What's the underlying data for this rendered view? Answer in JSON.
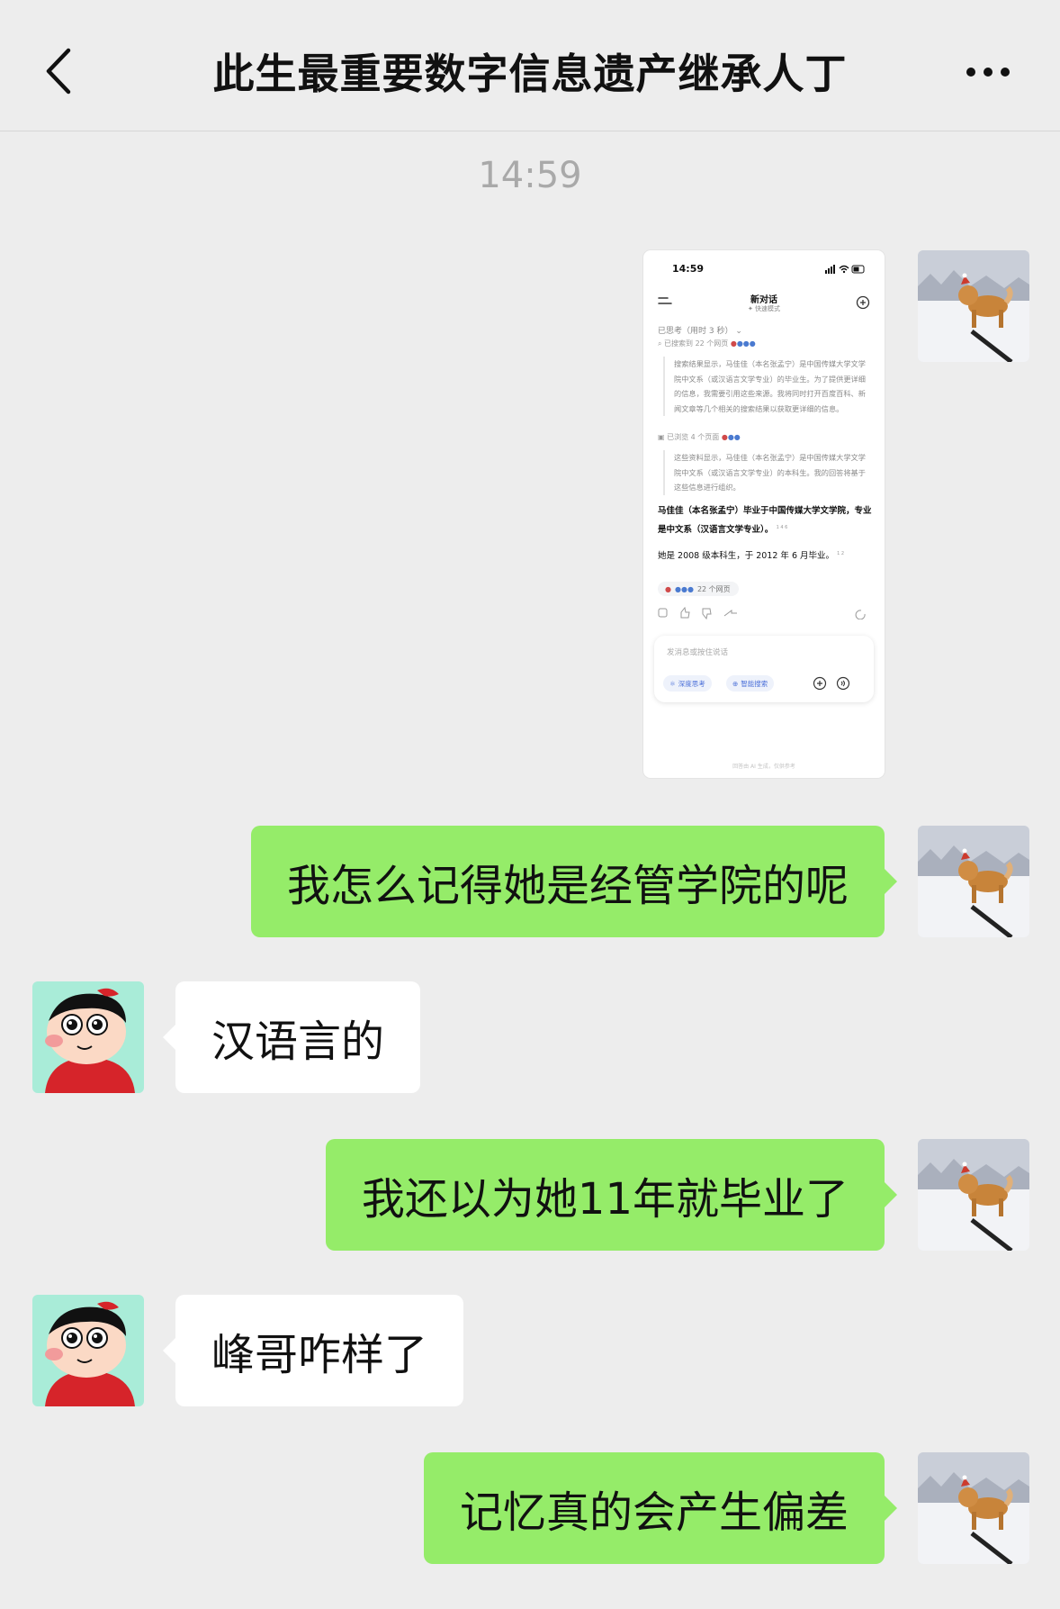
{
  "header": {
    "title": "此生最重要数字信息遗产继承人丁"
  },
  "timestamp": "14:59",
  "messages": [
    {
      "sender": "me",
      "type": "image"
    },
    {
      "sender": "me",
      "type": "text",
      "text": "我怎么记得她是经管学院的呢"
    },
    {
      "sender": "other",
      "type": "text",
      "text": "汉语言的"
    },
    {
      "sender": "me",
      "type": "text",
      "text": "我还以为她11年就毕业了"
    },
    {
      "sender": "other",
      "type": "text",
      "text": "峰哥咋样了"
    },
    {
      "sender": "me",
      "type": "text",
      "text": "记忆真的会产生偏差"
    }
  ],
  "shared_screenshot": {
    "status_time": "14:59",
    "title": "新对话",
    "subtitle": "快速模式",
    "thinking": "已思考（用时 3 秒）",
    "searched": "已搜索到 22 个网页",
    "quote1": "搜索结果显示，马佳佳（本名张孟宁）是中国传媒大学文学院中文系（或汉语言文学专业）的毕业生。为了提供更详细的信息，我需要引用这些来源。我将同时打开百度百科、新闻文章等几个相关的搜索结果以获取更详细的信息。",
    "browsed": "已浏览 4 个页面",
    "quote2": "这些资料显示，马佳佳（本名张孟宁）是中国传媒大学文学院中文系（或汉语言文学专业）的本科生。我的回答将基于这些信息进行组织。",
    "answer1": "马佳佳（本名张孟宁）毕业于中国传媒大学文学院，专业是中文系（汉语言文学专业）。",
    "answer1_refs": "1 4 6",
    "answer2": "她是 2008 级本科生，于 2012 年 6 月毕业。",
    "answer2_refs": "1 2",
    "sources": "22 个网页",
    "input_placeholder": "发消息或按住说话",
    "chip_deep": "深度思考",
    "chip_search": "智能搜索",
    "footer": "回答由 AI 生成，仅供参考"
  },
  "colors": {
    "background": "#ededed",
    "my_bubble": "#95ec69",
    "other_bubble": "#ffffff",
    "timestamp": "#a9a9a9"
  },
  "icons": {
    "back": "chevron-left-icon",
    "more": "more-dots-icon"
  }
}
